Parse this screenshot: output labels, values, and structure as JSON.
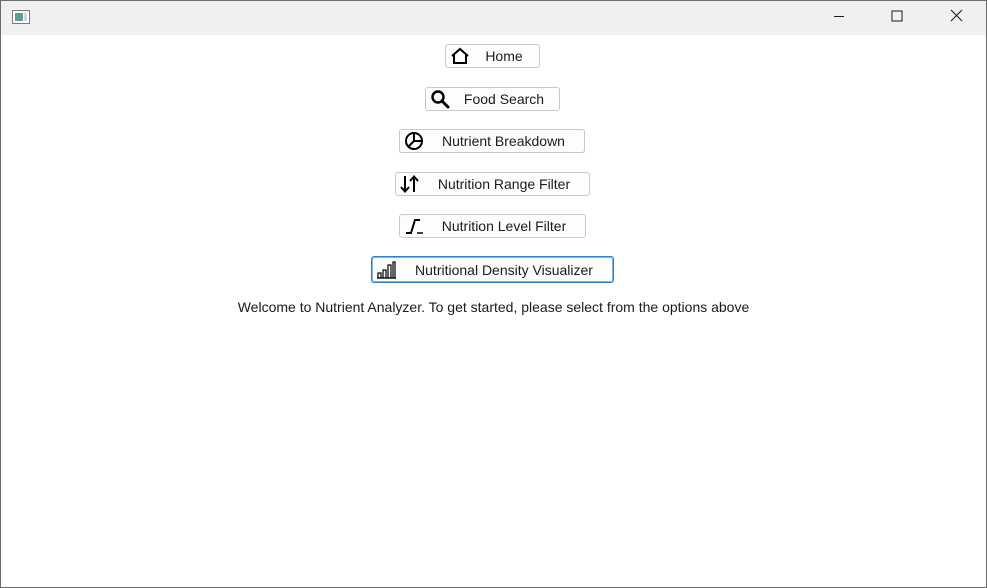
{
  "titlebar": {
    "icons": {
      "app": "app-window-icon",
      "minimize": "minimize-icon",
      "maximize": "maximize-icon",
      "close": "close-icon"
    }
  },
  "nav": {
    "home": {
      "label": "Home",
      "icon": "home-icon"
    },
    "food_search": {
      "label": "Food Search",
      "icon": "search-icon"
    },
    "nutrient_breakdown": {
      "label": "Nutrient Breakdown",
      "icon": "pie-chart-icon"
    },
    "range_filter": {
      "label": "Nutrition Range Filter",
      "icon": "sort-arrows-icon"
    },
    "level_filter": {
      "label": "Nutrition Level Filter",
      "icon": "step-function-icon"
    },
    "density_visualizer": {
      "label": "Nutritional Density Visualizer",
      "icon": "bar-chart-icon",
      "focused": true
    }
  },
  "welcome_text": "Welcome to Nutrient Analyzer. To get started, please select from the options above",
  "colors": {
    "titlebar_bg": "#f0f0f0",
    "focus_border": "#2f7fd3",
    "button_border": "#c9c9c9"
  }
}
